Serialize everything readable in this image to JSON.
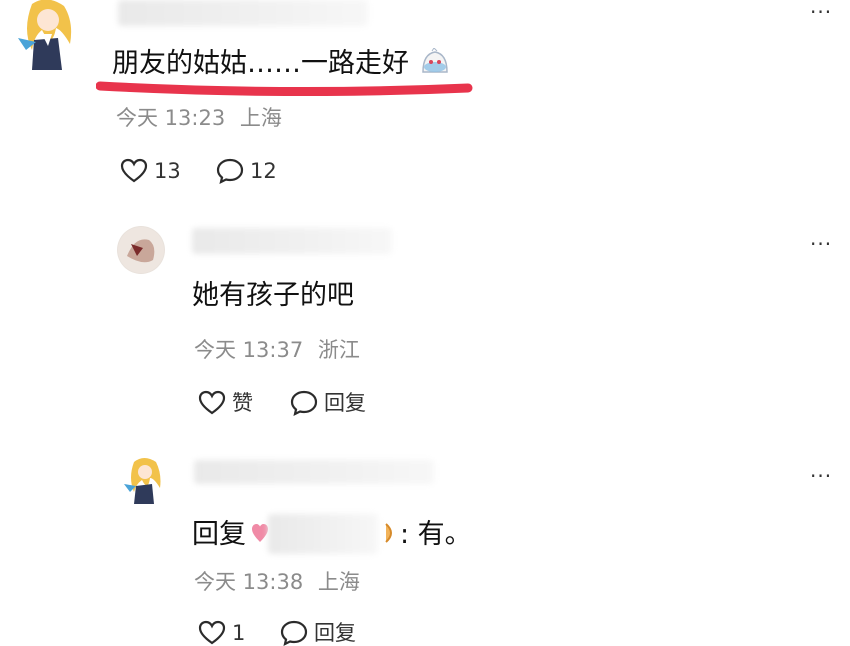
{
  "comments": [
    {
      "text": "朋友的姑姑……一路走好",
      "time": "今天 13:23",
      "location": "上海",
      "likes": "13",
      "replies": "12",
      "underline_color": "#e8344c"
    },
    {
      "text": "她有孩子的吧",
      "time": "今天 13:37",
      "location": "浙江",
      "like_label": "赞",
      "reply_label": "回复"
    },
    {
      "reply_prefix": "回复",
      "text": ": 有。",
      "time": "今天 13:38",
      "location": "上海",
      "likes": "1",
      "reply_label": "回复"
    }
  ],
  "more_label": "···",
  "icons": [
    "heart-icon",
    "comment-bubble-icon",
    "more-icon",
    "emoji-icon"
  ]
}
